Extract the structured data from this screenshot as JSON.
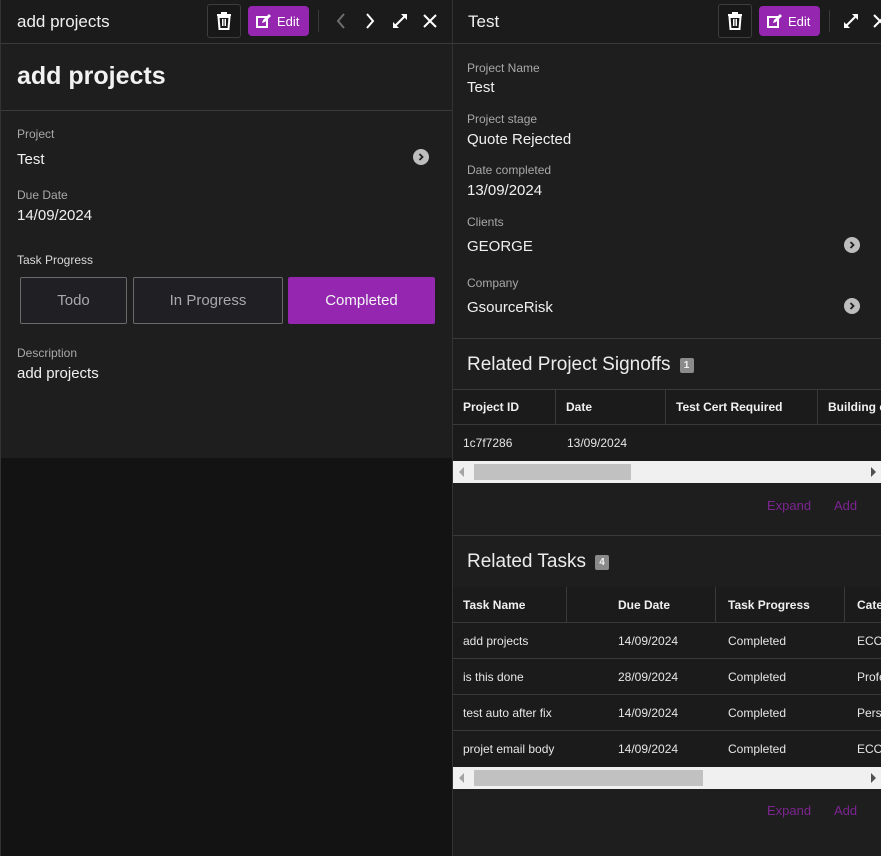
{
  "colors": {
    "accent": "#9526b0",
    "link": "#7d2492",
    "background": "#1e1e1e"
  },
  "left_panel": {
    "header_title": "add projects",
    "edit_label": "Edit",
    "icons": [
      "trash-icon",
      "edit-icon",
      "chevron-left-icon",
      "chevron-right-icon",
      "expand-icon",
      "close-icon"
    ],
    "page_title": "add projects",
    "fields": {
      "project_label": "Project",
      "project_value": "Test",
      "due_date_label": "Due Date",
      "due_date_value": "14/09/2024",
      "task_progress_label": "Task Progress",
      "description_label": "Description",
      "description_value": "add projects"
    },
    "progress_options": [
      {
        "label": "Todo",
        "selected": false
      },
      {
        "label": "In Progress",
        "selected": false
      },
      {
        "label": "Completed",
        "selected": true
      }
    ]
  },
  "right_panel": {
    "header_title": "Test",
    "edit_label": "Edit",
    "fields": {
      "project_name_label": "Project Name",
      "project_name_value": "Test",
      "project_stage_label": "Project stage",
      "project_stage_value": "Quote Rejected",
      "date_completed_label": "Date completed",
      "date_completed_value": "13/09/2024",
      "clients_label": "Clients",
      "clients_value": "GEORGE",
      "company_label": "Company",
      "company_value": "GsourceRisk"
    },
    "signoffs": {
      "title": "Related Project Signoffs",
      "count": "1",
      "columns": [
        "Project ID",
        "Date",
        "Test Cert Required",
        "Building c"
      ],
      "rows": [
        [
          "1c7f7286",
          "13/09/2024",
          "",
          ""
        ]
      ],
      "expand_label": "Expand",
      "add_label": "Add"
    },
    "tasks": {
      "title": "Related Tasks",
      "count": "4",
      "columns": [
        "Task Name",
        "",
        "Due Date",
        "Task Progress",
        "Cate"
      ],
      "rows": [
        [
          "add projects",
          "14/09/2024",
          "Completed",
          "ECO"
        ],
        [
          "is this done",
          "28/09/2024",
          "Completed",
          "Profe"
        ],
        [
          "test auto after fix",
          "14/09/2024",
          "Completed",
          "Pers"
        ],
        [
          "projet email body",
          "14/09/2024",
          "Completed",
          "ECO"
        ]
      ],
      "expand_label": "Expand",
      "add_label": "Add"
    }
  }
}
